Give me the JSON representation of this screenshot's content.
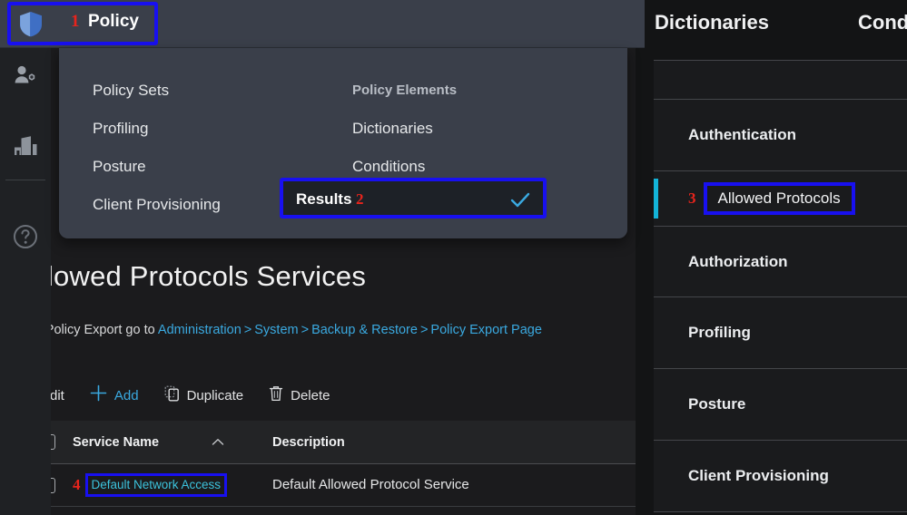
{
  "colors": {
    "annotation_border": "#1810f0",
    "annotation_number": "#e8241c",
    "accent_link": "#3aa9e0",
    "accent_cyan": "#13b4d8",
    "topbar_bg": "#3a3f4a",
    "page_bg": "#1b1b1d",
    "panel_bg": "#131415"
  },
  "rail": {
    "items": [
      {
        "icon": "person-gear-icon",
        "name": "administration"
      },
      {
        "icon": "bar-chart-icon",
        "name": "operations"
      },
      {
        "icon": "help-circle-icon",
        "name": "help"
      }
    ]
  },
  "topbar": {
    "policy_tab": {
      "icon": "shield-icon",
      "annotation": "1",
      "label": "Policy"
    }
  },
  "dropdown": {
    "left_column": [
      {
        "label": "Policy Sets"
      },
      {
        "label": "Profiling"
      },
      {
        "label": "Posture"
      },
      {
        "label": "Client Provisioning"
      }
    ],
    "right_column_heading": "Policy Elements",
    "right_column": [
      {
        "label": "Dictionaries"
      },
      {
        "label": "Conditions"
      }
    ],
    "selected_item": {
      "label": "Results",
      "annotation": "2",
      "check_icon": "check-icon"
    }
  },
  "main": {
    "title": "Allowed Protocols Services",
    "breadcrumb": {
      "prefix": "For Policy Export go to ",
      "links": [
        "Administration",
        "System",
        "Backup & Restore",
        "Policy Export Page"
      ],
      "separator": ">"
    },
    "toolbar": [
      {
        "label": "Edit",
        "icon": "pencil-icon",
        "name": "edit-button"
      },
      {
        "label": "Add",
        "icon": "plus-icon",
        "name": "add-button"
      },
      {
        "label": "Duplicate",
        "icon": "copy-icon",
        "name": "duplicate-button"
      },
      {
        "label": "Delete",
        "icon": "trash-icon",
        "name": "delete-button"
      }
    ],
    "table": {
      "columns": [
        {
          "label": "Service Name",
          "sort_icon": "caret-up-icon"
        },
        {
          "label": "Description"
        }
      ],
      "rows": [
        {
          "annotation": "4",
          "service_name": "Default Network Access",
          "description": "Default Allowed Protocol Service"
        }
      ]
    }
  },
  "right_panel": {
    "tabs": [
      {
        "label": "Dictionaries"
      },
      {
        "label": "Conditions"
      }
    ],
    "sections": [
      {
        "label": "Authentication",
        "sub_item": {
          "annotation": "3",
          "label": "Allowed Protocols"
        }
      },
      {
        "label": "Authorization"
      },
      {
        "label": "Profiling"
      },
      {
        "label": "Posture"
      },
      {
        "label": "Client Provisioning"
      }
    ]
  }
}
